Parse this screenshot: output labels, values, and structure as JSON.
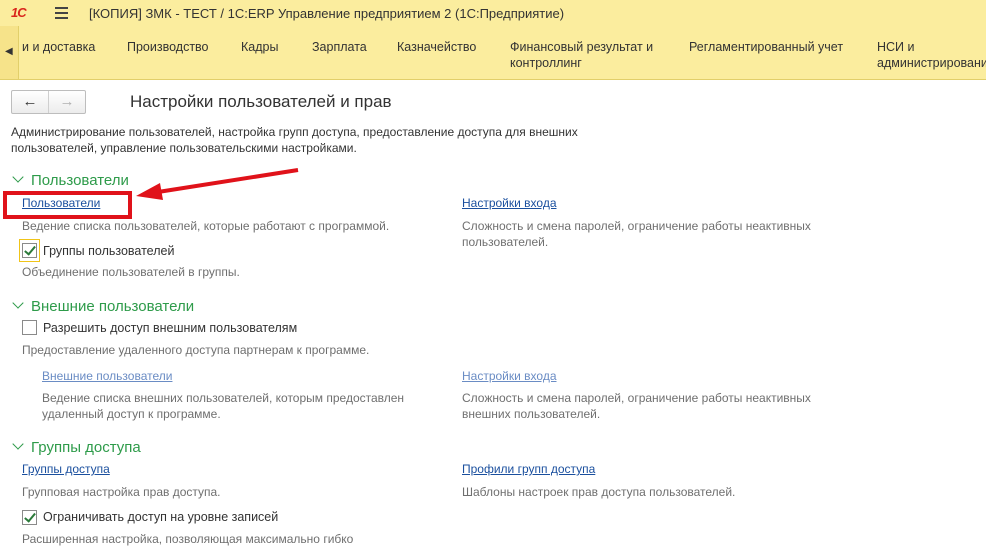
{
  "titlebar": {
    "logo": "1С",
    "title": "[КОПИЯ] ЗМК - ТЕСТ / 1С:ERP Управление предприятием 2  (1С:Предприятие)"
  },
  "menu": {
    "scroll_left_icon": "◀",
    "items": [
      {
        "label": "и и доставка"
      },
      {
        "label": "Производство"
      },
      {
        "label": "Кадры"
      },
      {
        "label": "Зарплата"
      },
      {
        "label": "Казначейство"
      },
      {
        "label": "Финансовый результат и контроллинг"
      },
      {
        "label": "Регламентированный учет"
      },
      {
        "label": "НСИ и администрирование"
      }
    ]
  },
  "page": {
    "title": "Настройки пользователей и прав",
    "intro": "Администрирование пользователей, настройка групп доступа, предоставление доступа для внешних пользователей, управление пользовательскими настройками."
  },
  "users": {
    "header": "Пользователи",
    "users_link": "Пользователи",
    "users_desc": "Ведение списка пользователей, которые работают с программой.",
    "login_link": "Настройки входа",
    "login_desc": "Сложность и смена паролей, ограничение работы неактивных пользователей.",
    "groups_label": "Группы пользователей",
    "groups_checked": true,
    "groups_desc": "Объединение пользователей в группы."
  },
  "external": {
    "header": "Внешние пользователи",
    "allow_label": "Разрешить доступ внешним пользователям",
    "allow_checked": false,
    "allow_desc": "Предоставление удаленного доступа партнерам к программе.",
    "ext_link": "Внешние пользователи",
    "ext_desc": "Ведение списка внешних пользователей, которым предоставлен удаленный доступ к программе.",
    "login_link": "Настройки входа",
    "login_desc": "Сложность и смена паролей, ограничение работы неактивных внешних пользователей."
  },
  "access": {
    "header": "Группы доступа",
    "groups_link": "Группы доступа",
    "groups_desc": "Групповая настройка прав доступа.",
    "profiles_link": "Профили групп доступа",
    "profiles_desc": "Шаблоны настроек прав доступа пользователей.",
    "restrict_label": "Ограничивать доступ на уровне записей",
    "restrict_checked": true,
    "restrict_desc": "Расширенная настройка, позволяющая максимально гибко"
  },
  "colors": {
    "accent_green": "#2e9b4a",
    "link_blue": "#1a4f9e",
    "annotation_red": "#e0121a",
    "bar_yellow": "#fbed9e"
  }
}
